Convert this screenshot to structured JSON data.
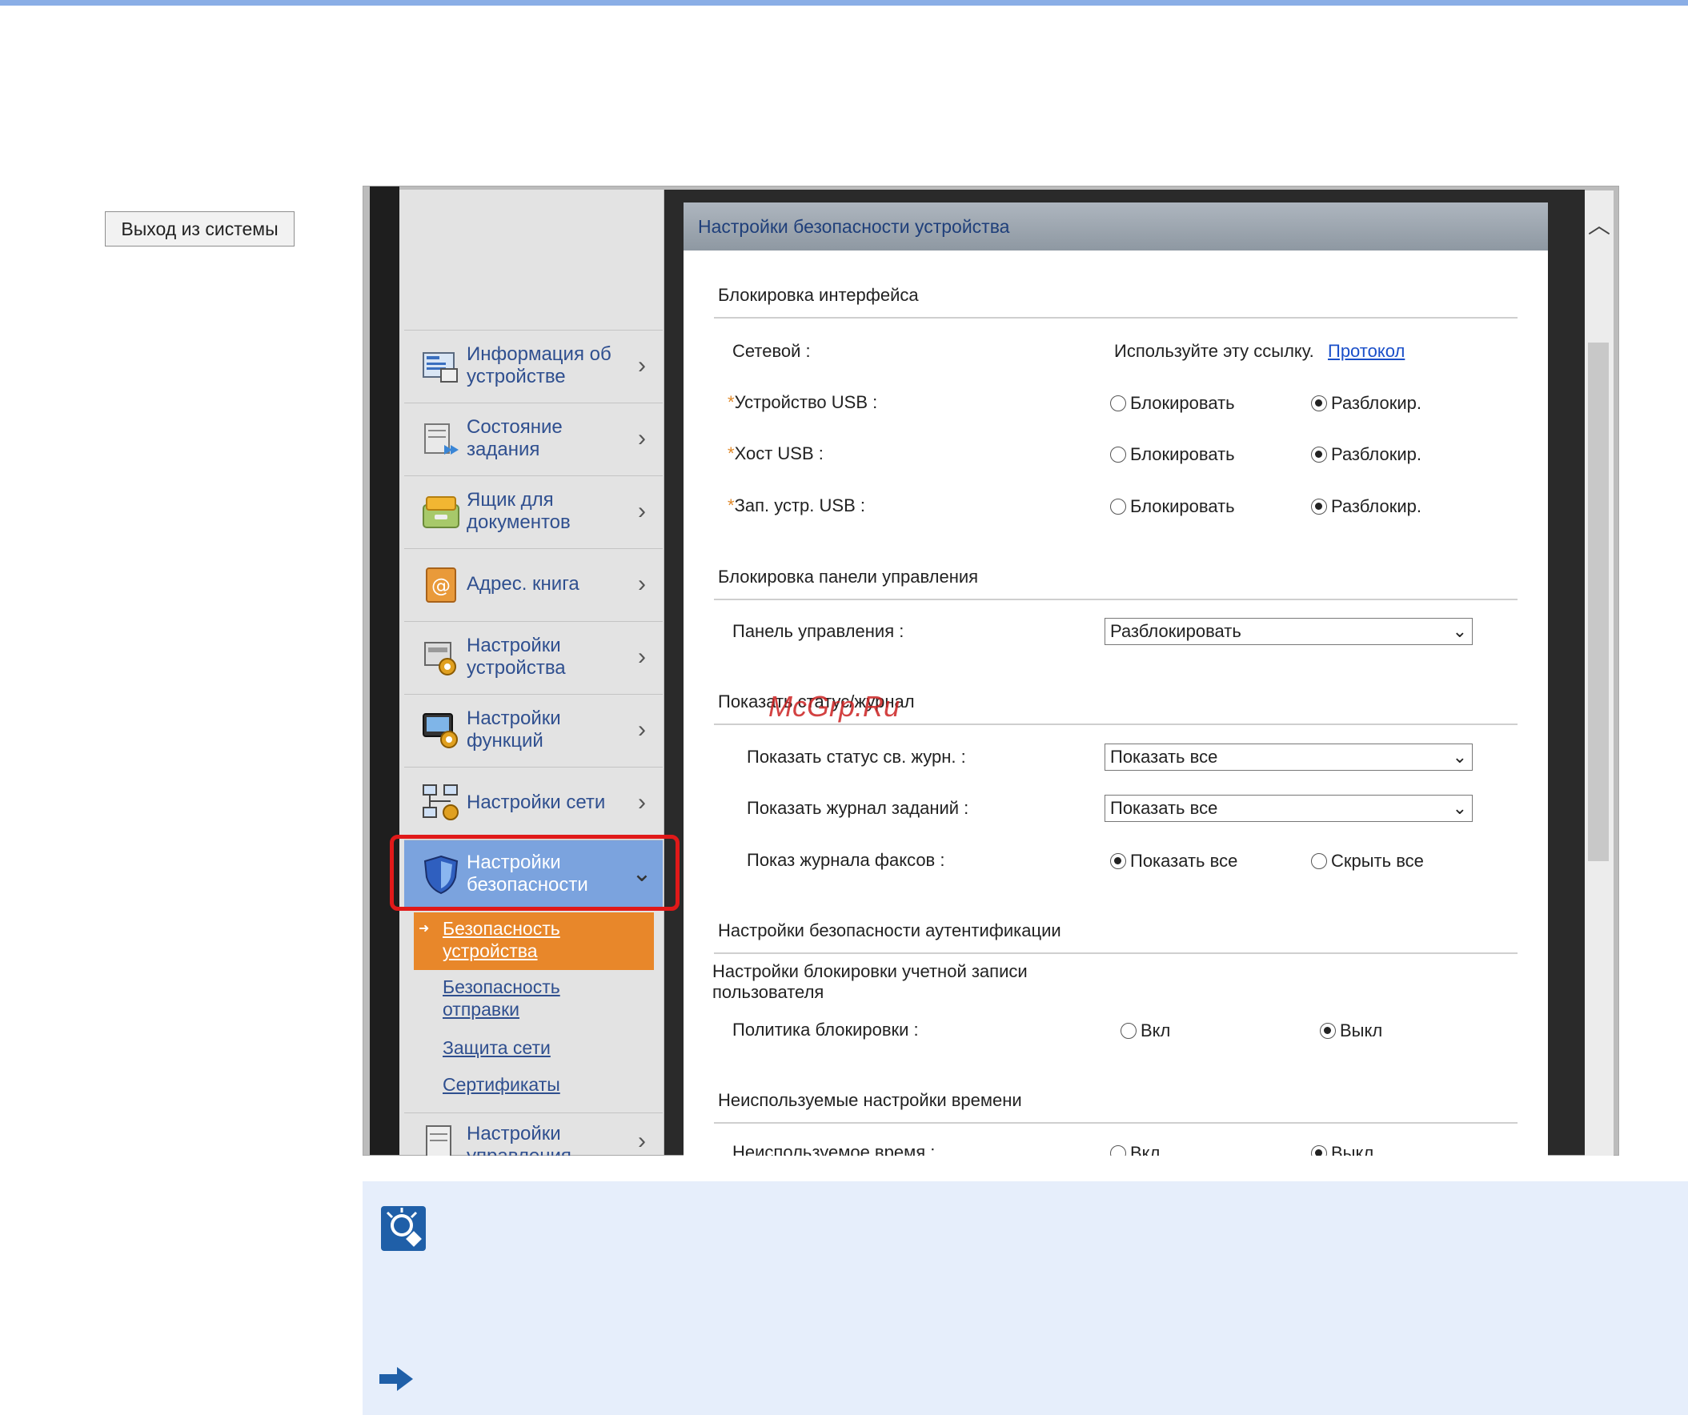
{
  "header": {
    "title": "Настройки безопасности устройства"
  },
  "sidebar": {
    "logout_label": "Выход из системы",
    "items": [
      {
        "label": "Информация об устройстве",
        "icon": "device-info-icon"
      },
      {
        "label": "Состояние задания",
        "icon": "job-status-icon"
      },
      {
        "label": "Ящик для документов",
        "icon": "document-box-icon"
      },
      {
        "label": "Адрес. книга",
        "icon": "address-book-icon"
      },
      {
        "label": "Настройки устройства",
        "icon": "device-settings-icon"
      },
      {
        "label": "Настройки функций",
        "icon": "function-settings-icon"
      },
      {
        "label": "Настройки сети",
        "icon": "network-settings-icon"
      },
      {
        "label": "Настройки безопасности",
        "icon": "shield-icon",
        "active": true
      },
      {
        "label": "Настройки управления",
        "icon": "management-settings-icon"
      }
    ],
    "subitems": [
      {
        "label": "Безопасность устройства",
        "active": true
      },
      {
        "label": "Безопасность отправки"
      },
      {
        "label": "Защита сети"
      },
      {
        "label": "Сертификаты"
      }
    ]
  },
  "sections": {
    "interface_lock": {
      "title": "Блокировка интерфейса",
      "network_label": "Сетевой :",
      "network_hint": "Используйте эту ссылку.",
      "network_link": "Протокол",
      "usb_device_label": "Устройство USB :",
      "usb_host_label": "Хост USB :",
      "usb_storage_label": "Зап. устр. USB :",
      "lock_option": "Блокировать",
      "unlock_option": "Разблокир."
    },
    "panel_lock": {
      "title": "Блокировка панели управления",
      "panel_label": "Панель управления :",
      "panel_value": "Разблокировать"
    },
    "status_log": {
      "title": "Показать статус/журнал",
      "status_label": "Показать статус св. журн. :",
      "status_value": "Показать все",
      "jobs_label": "Показать журнал заданий :",
      "jobs_value": "Показать все",
      "fax_label": "Показ журнала факсов :",
      "fax_show": "Показать все",
      "fax_hide": "Скрыть все"
    },
    "auth": {
      "title": "Настройки безопасности аутентификации",
      "subtitle": "Настройки блокировки учетной записи пользователя",
      "policy_label": "Политика блокировки :",
      "on": "Вкл",
      "off": "Выкл"
    },
    "unused_time": {
      "title": "Неиспользуемые настройки времени",
      "label": "Неиспользуемое время :",
      "on": "Вкл",
      "off": "Выкл"
    }
  },
  "watermark": "McGrp.Ru",
  "colors": {
    "accent": "#7ba3de",
    "active_sub": "#e8872a",
    "highlight": "#e01919",
    "link": "#1a4fc9"
  }
}
